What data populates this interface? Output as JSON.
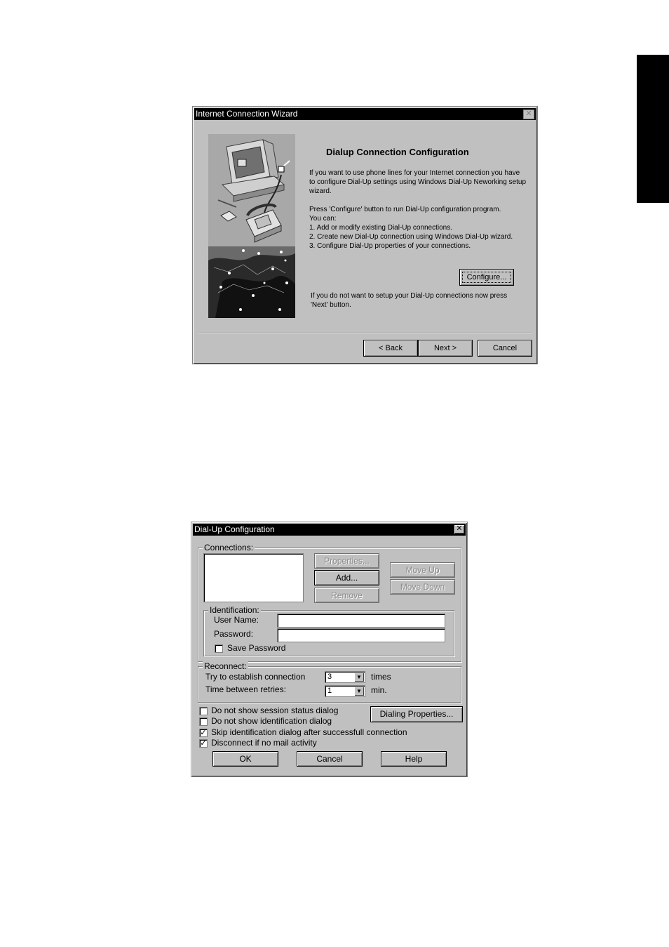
{
  "wizard": {
    "title": "Internet Connection Wizard",
    "heading": "Dialup Connection Configuration",
    "para1": "If you want to use phone lines for your Internet connection you have to configure Dial-Up settings using Windows Dial-Up Neworking setup wizard.",
    "para2_lines": [
      "Press 'Configure' button to run Dial-Up configuration program.",
      "You can:",
      "1. Add or modify existing Dial-Up connections.",
      "2. Create new  Dial-Up connection using  Windows Dial-Up wizard.",
      "3. Configure Dial-Up  properties of your connections."
    ],
    "configure_label": "Configure...",
    "para3": "If you do not want to setup your Dial-Up connections now press 'Next' button.",
    "back_label": "< Back",
    "next_label": "Next >",
    "cancel_label": "Cancel"
  },
  "dialup": {
    "title": "Dial-Up Configuration",
    "connections_label": "Connections:",
    "properties_label": "Properties...",
    "add_label": "Add...",
    "remove_label": "Remove",
    "move_up_label": "Move Up",
    "move_down_label": "Move Down",
    "identification_label": "Identification:",
    "user_name_label": "User Name:",
    "user_name_value": "",
    "password_label": "Password:",
    "password_value": "",
    "save_password_label": "Save Password",
    "save_password_checked": false,
    "reconnect_label": "Reconnect:",
    "try_label": "Try to establish connection",
    "try_value": "3",
    "times_label": "times",
    "retry_label": "Time between retries:",
    "retry_value": "1",
    "min_label": "min.",
    "options": [
      {
        "label": "Do not show session status dialog",
        "checked": false
      },
      {
        "label": "Do not show identification dialog",
        "checked": false
      },
      {
        "label": "Skip identification dialog after successfull connection",
        "checked": true
      },
      {
        "label": "Disconnect if no mail activity",
        "checked": true
      }
    ],
    "dialing_properties_label": "Dialing Properties...",
    "ok_label": "OK",
    "cancel_label": "Cancel",
    "help_label": "Help"
  }
}
